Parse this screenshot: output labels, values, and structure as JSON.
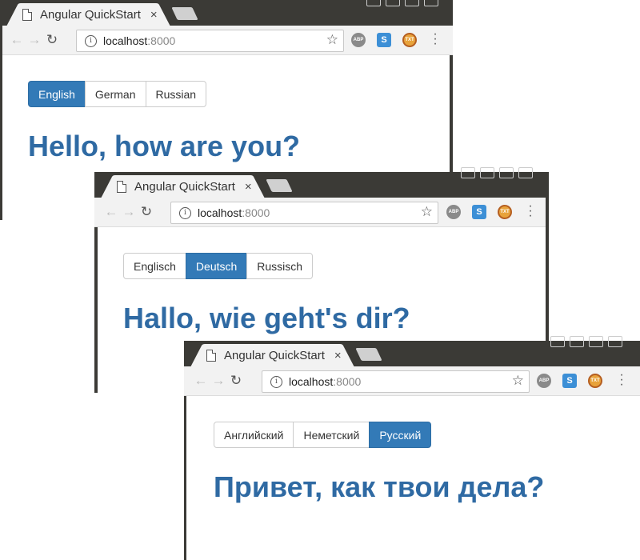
{
  "windows": [
    {
      "tab_title": "Angular QuickStart",
      "tab_close": "×",
      "url_host": "localhost",
      "url_port": ":8000",
      "languages": [
        "English",
        "German",
        "Russian"
      ],
      "active_language": "English",
      "greeting": "Hello, how are you?"
    },
    {
      "tab_title": "Angular QuickStart",
      "tab_close": "×",
      "url_host": "localhost",
      "url_port": ":8000",
      "languages": [
        "Englisch",
        "Deutsch",
        "Russisch"
      ],
      "active_language": "Deutsch",
      "greeting": "Hallo, wie geht's dir?"
    },
    {
      "tab_title": "Angular QuickStart",
      "tab_close": "×",
      "url_host": "localhost",
      "url_port": ":8000",
      "languages": [
        "Английский",
        "Неметский",
        "Русский"
      ],
      "active_language": "Русский",
      "greeting": "Привет, как твои дела?"
    }
  ],
  "extensions": {
    "abp_label": "ABP",
    "s_label": "S",
    "txt_label": "TXT"
  },
  "colors": {
    "accent": "#337ab7",
    "greeting": "#2f6aa3",
    "titlebar": "#3b3a36"
  }
}
